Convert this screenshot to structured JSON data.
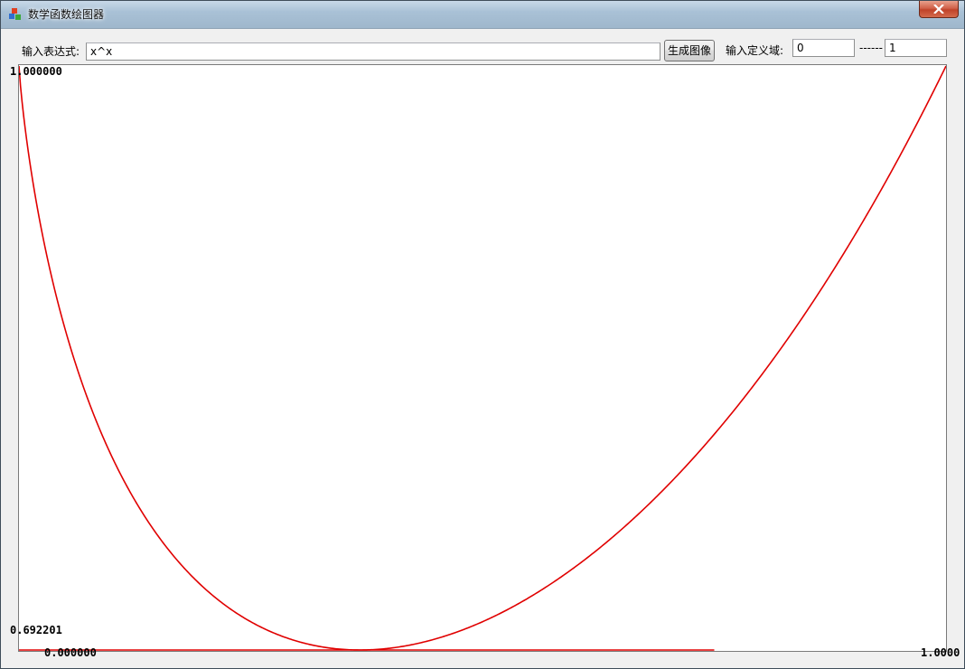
{
  "window": {
    "title": "数学函数绘图器",
    "close_glyph": "✕"
  },
  "toolbar": {
    "expression_label": "输入表达式:",
    "expression_value": "x^x",
    "generate_button": "生成图像",
    "domain_label": "输入定义域:",
    "domain_start": "0",
    "domain_separator": "------",
    "domain_end": "1"
  },
  "colors": {
    "curve": "#e00000",
    "accent": "#c0432a"
  },
  "chart_data": {
    "type": "line",
    "function": "x^x",
    "xlim": [
      0,
      1
    ],
    "ylim": [
      0.692201,
      1.0
    ],
    "y_max_label": "1.000000",
    "y_min_label": "0.692201",
    "x_min_label": "0.000000",
    "x_max_label": "1.0000",
    "series": [
      {
        "x": [
          0.0,
          0.05,
          0.1,
          0.15,
          0.2,
          0.25,
          0.3,
          0.35,
          0.3679,
          0.4,
          0.45,
          0.5,
          0.55,
          0.6,
          0.65,
          0.7,
          0.75,
          0.8,
          0.85,
          0.9,
          0.95,
          1.0
        ],
        "y": [
          1.0,
          0.861,
          0.794,
          0.752,
          0.725,
          0.707,
          0.697,
          0.693,
          0.6922,
          0.693,
          0.698,
          0.707,
          0.72,
          0.736,
          0.756,
          0.779,
          0.806,
          0.837,
          0.871,
          0.91,
          0.953,
          1.0
        ]
      }
    ]
  }
}
